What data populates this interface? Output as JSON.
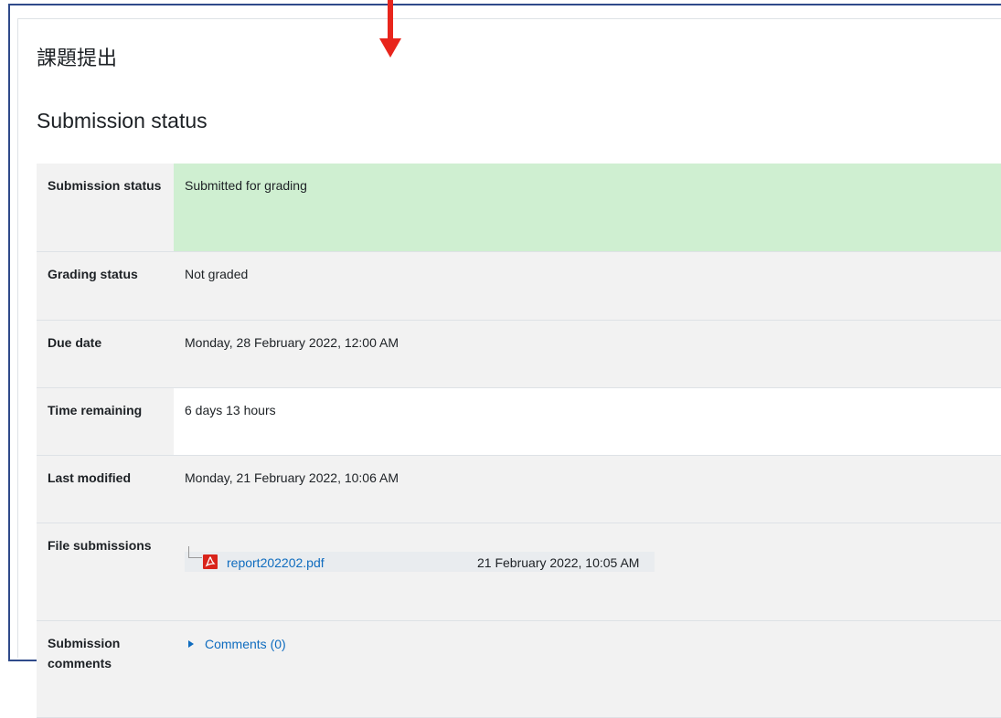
{
  "page": {
    "title": "課題提出"
  },
  "section": {
    "title": "Submission status"
  },
  "rows": {
    "submission_status": {
      "label": "Submission status",
      "value": "Submitted for grading"
    },
    "grading_status": {
      "label": "Grading status",
      "value": "Not graded"
    },
    "due_date": {
      "label": "Due date",
      "value": "Monday, 28 February 2022, 12:00 AM"
    },
    "time_remaining": {
      "label": "Time remaining",
      "value": "6 days 13 hours"
    },
    "last_modified": {
      "label": "Last modified",
      "value": "Monday, 21 February 2022, 10:06 AM"
    },
    "file_submissions": {
      "label": "File submissions",
      "file": {
        "name": "report202202.pdf",
        "date": "21 February 2022, 10:05 AM",
        "icon": "pdf-file-icon"
      }
    },
    "submission_comments": {
      "label": "Submission comments",
      "link": "Comments (0)",
      "icon": "triangle-right-icon"
    }
  },
  "colors": {
    "annotation_arrow": "#e8251c",
    "submitted_bg": "#cfefd1",
    "link": "#0f6cbf",
    "frame_border": "#2f4a8a"
  }
}
